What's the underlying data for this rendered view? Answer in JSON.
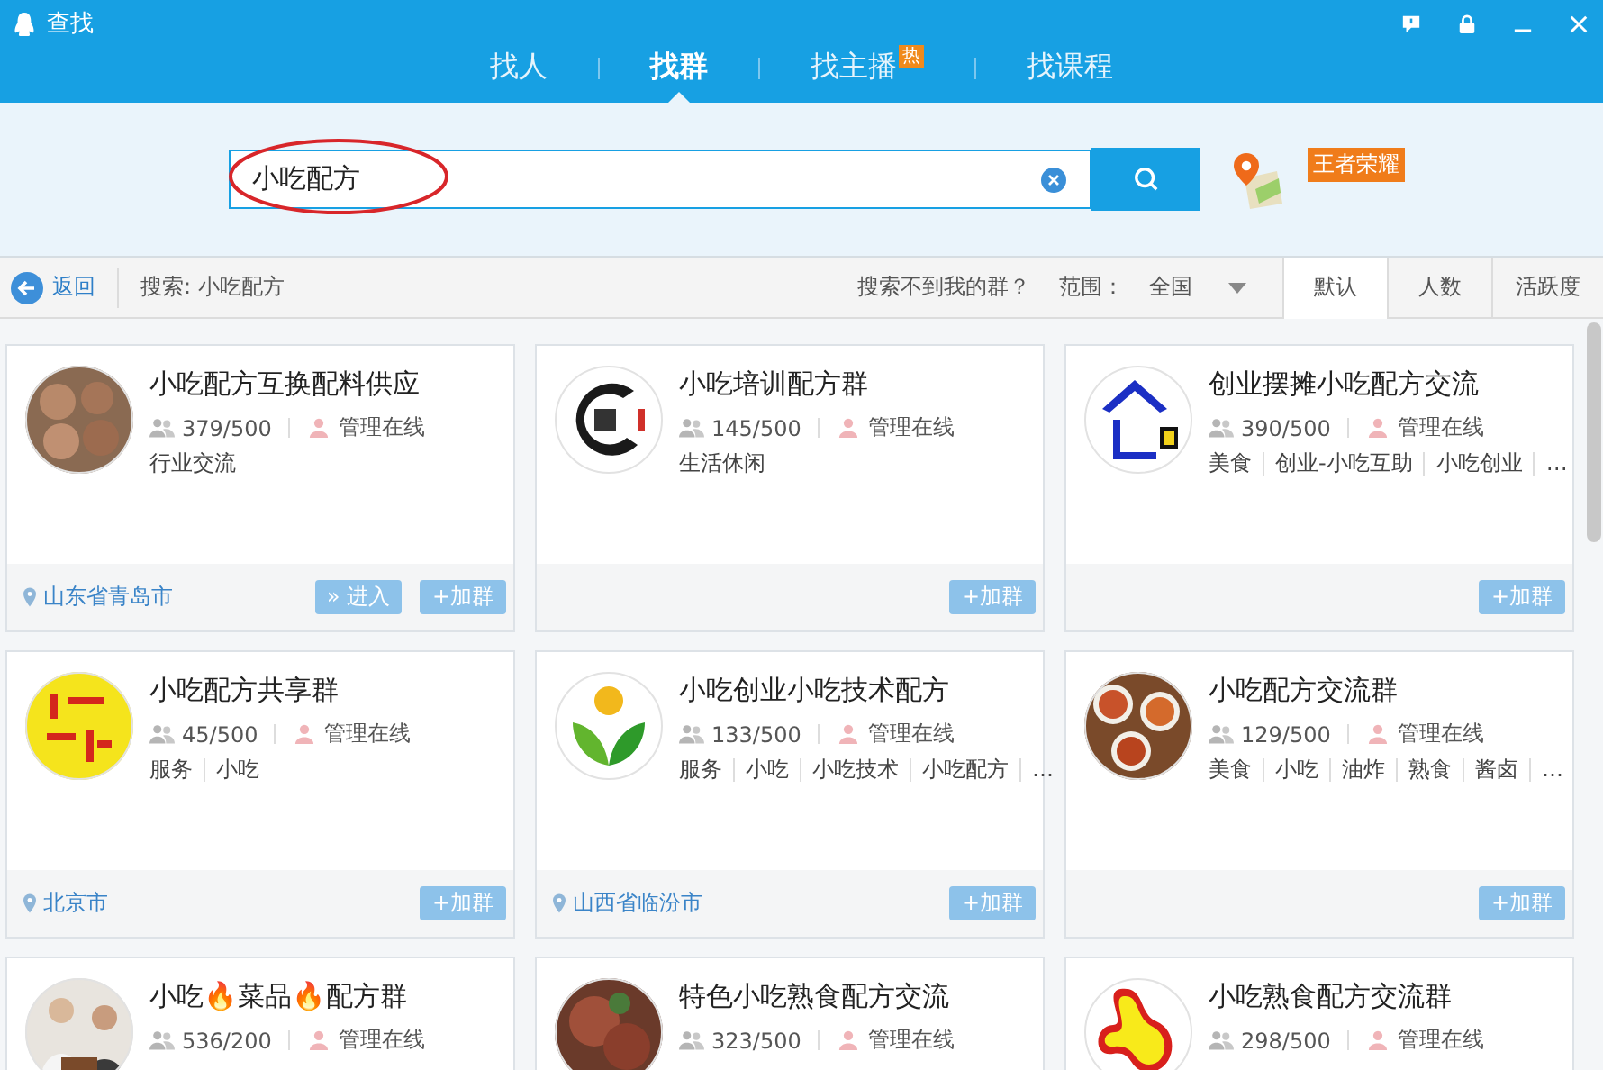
{
  "window": {
    "title": "查找"
  },
  "tabs": [
    {
      "label": "找人",
      "selected": false
    },
    {
      "label": "找群",
      "selected": true
    },
    {
      "label": "找主播",
      "selected": false,
      "badge": "热"
    },
    {
      "label": "找课程",
      "selected": false
    }
  ],
  "search": {
    "value": "小吃配方"
  },
  "promo_badge": "王者荣耀",
  "toolbar": {
    "back": "返回",
    "query": "搜索: 小吃配方",
    "help_link": "搜索不到我的群？",
    "scope_label": "范围：",
    "scope_value": "全国",
    "sort_tabs": [
      {
        "label": "默认",
        "selected": true
      },
      {
        "label": "人数",
        "selected": false
      },
      {
        "label": "活跃度",
        "selected": false
      }
    ]
  },
  "groups": [
    {
      "name": "小吃配方互换配料供应",
      "members": "379/500",
      "admin": "管理在线",
      "tags": [
        "行业交流"
      ],
      "location": "山东省青岛市",
      "enter": "» 进入",
      "join": "+加群"
    },
    {
      "name": "小吃培训配方群",
      "members": "145/500",
      "admin": "管理在线",
      "tags": [
        "生活休闲"
      ],
      "join": "+加群"
    },
    {
      "name": "创业摆摊小吃配方交流",
      "members": "390/500",
      "admin": "管理在线",
      "tags": [
        "美食",
        "创业-小吃互助",
        "小吃创业",
        "…"
      ],
      "join": "+加群"
    },
    {
      "name": "小吃配方共享群",
      "members": "45/500",
      "admin": "管理在线",
      "tags": [
        "服务",
        "小吃"
      ],
      "location": "北京市",
      "join": "+加群"
    },
    {
      "name": "小吃创业小吃技术配方",
      "members": "133/500",
      "admin": "管理在线",
      "tags": [
        "服务",
        "小吃",
        "小吃技术",
        "小吃配方",
        "…"
      ],
      "location": "山西省临汾市",
      "join": "+加群"
    },
    {
      "name": "小吃配方交流群",
      "members": "129/500",
      "admin": "管理在线",
      "tags": [
        "美食",
        "小吃",
        "油炸",
        "熟食",
        "酱卤",
        "…"
      ],
      "join": "+加群"
    },
    {
      "name": "小吃🔥菜品🔥配方群",
      "members": "536/200",
      "admin": "管理在线"
    },
    {
      "name": "特色小吃熟食配方交流",
      "members": "323/500",
      "admin": "管理在线"
    },
    {
      "name": "小吃熟食配方交流群",
      "members": "298/500",
      "admin": "管理在线"
    }
  ]
}
